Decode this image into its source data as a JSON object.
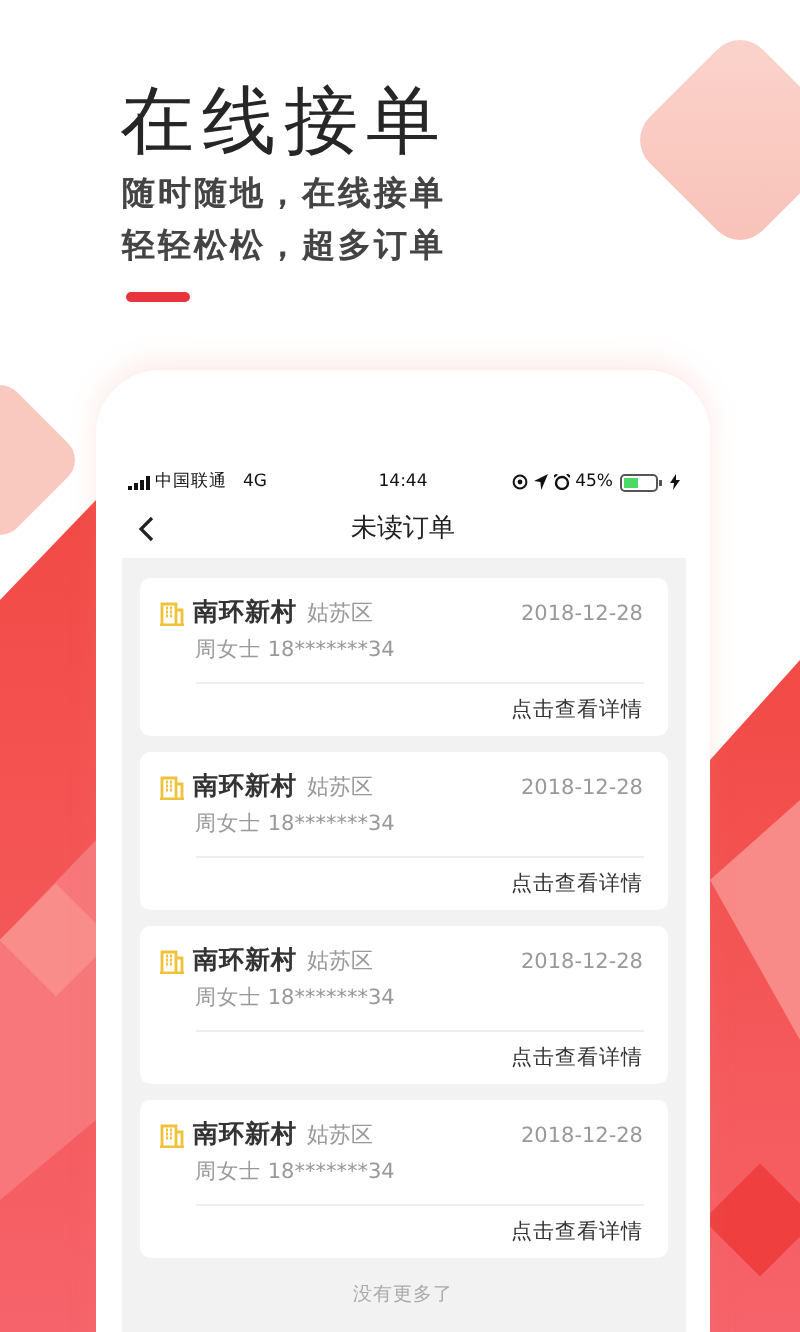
{
  "headline": "在线接单",
  "subtitle_lines": [
    "随时随地，在线接单",
    "轻轻松松，超多订单"
  ],
  "status_bar": {
    "carrier": "中国联通",
    "network": "4G",
    "time": "14:44",
    "battery": "45%"
  },
  "nav": {
    "title": "未读订单"
  },
  "orders": [
    {
      "name": "南环新村",
      "district": "姑苏区",
      "date": "2018-12-28",
      "contact": "周女士 18*******34",
      "action": "点击查看详情"
    },
    {
      "name": "南环新村",
      "district": "姑苏区",
      "date": "2018-12-28",
      "contact": "周女士 18*******34",
      "action": "点击查看详情"
    },
    {
      "name": "南环新村",
      "district": "姑苏区",
      "date": "2018-12-28",
      "contact": "周女士 18*******34",
      "action": "点击查看详情"
    },
    {
      "name": "南环新村",
      "district": "姑苏区",
      "date": "2018-12-28",
      "contact": "周女士 18*******34",
      "action": "点击查看详情"
    }
  ],
  "footer": "没有更多了"
}
